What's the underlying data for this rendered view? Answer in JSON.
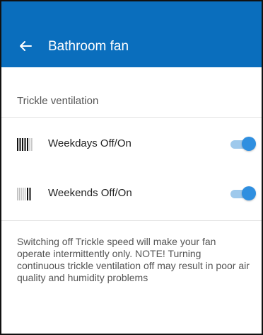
{
  "app_bar": {
    "title": "Bathroom fan",
    "color": "#0a6ebd",
    "back_icon": "arrow-left-icon"
  },
  "section": {
    "header": "Trickle ventilation"
  },
  "rows": [
    {
      "icon": "weekdays-calendar-icon",
      "label": "Weekdays Off/On",
      "enabled": true
    },
    {
      "icon": "weekends-calendar-icon",
      "label": "Weekends Off/On",
      "enabled": true
    }
  ],
  "toggle_colors": {
    "track_on": "#9ec9ec",
    "thumb_on": "#2f8fe0"
  },
  "description": "Switching off Trickle speed will make your fan operate intermittently only. NOTE! Turning continuous trickle ventilation off may result in poor air quality and humidity problems"
}
